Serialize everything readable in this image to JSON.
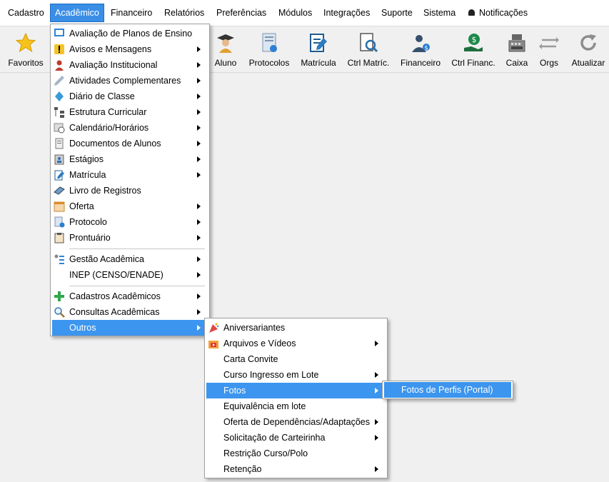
{
  "menubar": {
    "items": [
      "Cadastro",
      "Acadêmico",
      "Financeiro",
      "Relatórios",
      "Preferências",
      "Módulos",
      "Integrações",
      "Suporte",
      "Sistema"
    ],
    "notifications": "Notificações"
  },
  "toolbar": {
    "items": [
      "Favoritos",
      "Aluno",
      "Protocolos",
      "Matrícula",
      "Ctrl Matríc.",
      "Financeiro",
      "Ctrl Financ.",
      "Caixa",
      "Orgs",
      "Atualizar"
    ]
  },
  "academic_menu": {
    "items": [
      "Avaliação de Planos de Ensino",
      "Avisos e Mensagens",
      "Avaliação Institucional",
      "Atividades Complementares",
      "Diário de Classe",
      "Estrutura Curricular",
      "Calendário/Horários",
      "Documentos de Alunos",
      "Estágios",
      "Matrícula",
      "Livro de Registros",
      "Oferta",
      "Protocolo",
      "Prontuário",
      "Gestão Acadêmica",
      "INEP (CENSO/ENADE)",
      "Cadastros Acadêmicos",
      "Consultas Acadêmicas",
      "Outros"
    ]
  },
  "outros_menu": {
    "items": [
      "Aniversariantes",
      "Arquivos e Vídeos",
      "Carta Convite",
      "Curso Ingresso em Lote",
      "Fotos",
      "Equivalência em lote",
      "Oferta de Dependências/Adaptações",
      "Solicitação de Carteirinha",
      "Restrição Curso/Polo",
      "Retenção"
    ]
  },
  "fotos_menu": {
    "items": [
      "Fotos de Perfis (Portal)"
    ]
  },
  "colors": {
    "highlight": "#3c95ee",
    "menubar_active": "#3a8ee6"
  }
}
